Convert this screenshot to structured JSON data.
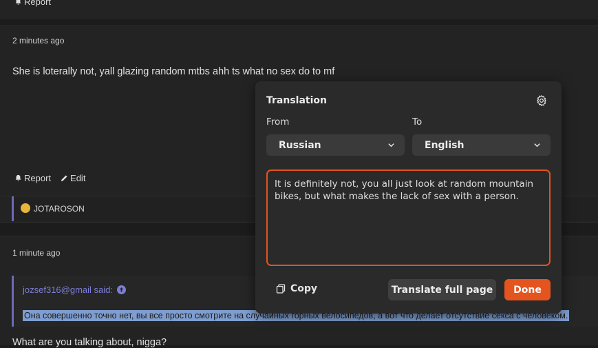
{
  "thread": {
    "top_report_label": "Report",
    "post1": {
      "time": "2 minutes ago",
      "body": "She is loterally not, yall glazing random mtbs ahh ts what no sex do to mf",
      "report_label": "Report",
      "edit_label": "Edit",
      "reaction_author": "JOTAROSON"
    },
    "post2": {
      "time": "1 minute ago",
      "quote_author": "jozsef316@gmail said:",
      "quote_text": "Она совершенно точно нет, вы все просто смотрите на случайных горных велосипедов, а вот что делает отсутствие секса с человеком.",
      "reply": "What are you talking about, nigga?"
    }
  },
  "translation": {
    "title": "Translation",
    "from_label": "From",
    "to_label": "To",
    "from_language": "Russian",
    "to_language": "English",
    "result": "It is definitely not, you all just look at random mountain bikes, but what makes the lack of sex with a person.",
    "copy_label": "Copy",
    "translate_full_label": "Translate full page",
    "done_label": "Done",
    "accent_color": "#e4541e"
  }
}
